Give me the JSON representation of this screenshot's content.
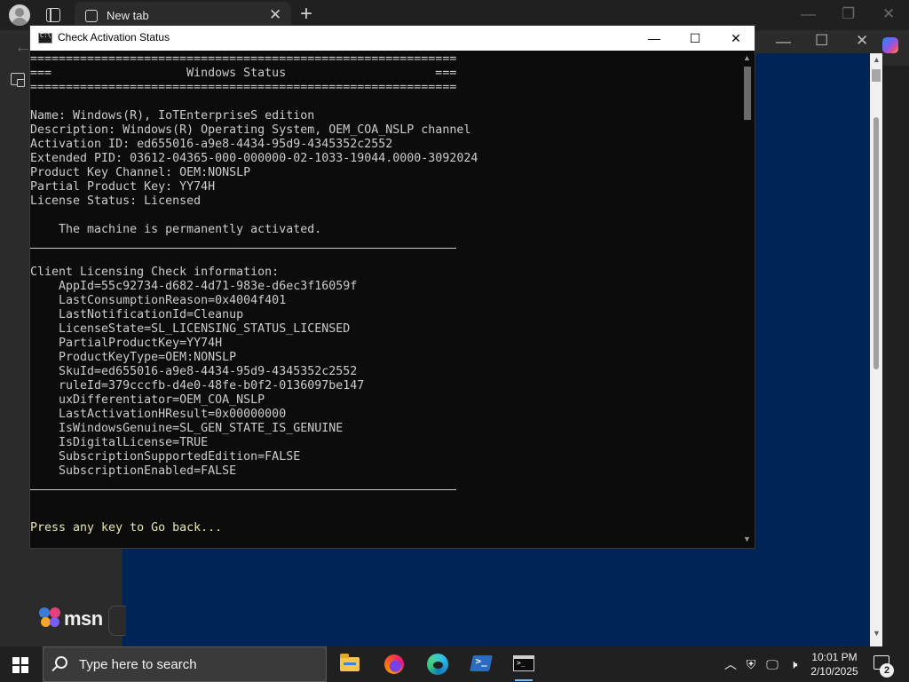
{
  "browser": {
    "tab_title": "New tab",
    "tab_close": "✕",
    "new_tab": "+",
    "msn_label": "msn"
  },
  "console": {
    "title": "Check Activation Status",
    "minimize": "—",
    "maximize": "☐",
    "close": "✕",
    "lines_header": [
      "============================================================",
      "===                   Windows Status                     ===",
      "============================================================"
    ],
    "lines_status": [
      "Name: Windows(R), IoTEnterpriseS edition",
      "Description: Windows(R) Operating System, OEM_COA_NSLP channel",
      "Activation ID: ed655016-a9e8-4434-95d9-4345352c2552",
      "Extended PID: 03612-04365-000-000000-02-1033-19044.0000-3092024",
      "Product Key Channel: OEM:NONSLP",
      "Partial Product Key: YY74H",
      "License Status: Licensed",
      "",
      "    The machine is permanently activated."
    ],
    "lines_client": [
      "Client Licensing Check information:",
      "    AppId=55c92734-d682-4d71-983e-d6ec3f16059f",
      "    LastConsumptionReason=0x4004f401",
      "    LastNotificationId=Cleanup",
      "    LicenseState=SL_LICENSING_STATUS_LICENSED",
      "    PartialProductKey=YY74H",
      "    ProductKeyType=OEM:NONSLP",
      "    SkuId=ed655016-a9e8-4434-95d9-4345352c2552",
      "    ruleId=379cccfb-d4e0-48fe-b0f2-0136097be147",
      "    uxDifferentiator=OEM_COA_NSLP",
      "    LastActivationHResult=0x00000000",
      "    IsWindowsGenuine=SL_GEN_STATE_IS_GENUINE",
      "    IsDigitalLicense=TRUE",
      "    SubscriptionSupportedEdition=FALSE",
      "    SubscriptionEnabled=FALSE"
    ],
    "prompt": "Press any key to Go back..."
  },
  "taskbar": {
    "search_placeholder": "Type here to search",
    "apps": [
      "File Explorer",
      "Firefox",
      "Microsoft Edge",
      "Windows PowerShell",
      "Command Prompt"
    ],
    "time": "10:01 PM",
    "date": "2/10/2025",
    "notification_count": "2"
  },
  "colors": {
    "console_bg": "#0c0c0c",
    "console_text": "#cccccc",
    "powershell_bg": "#012456",
    "taskbar_bg": "#202020"
  }
}
